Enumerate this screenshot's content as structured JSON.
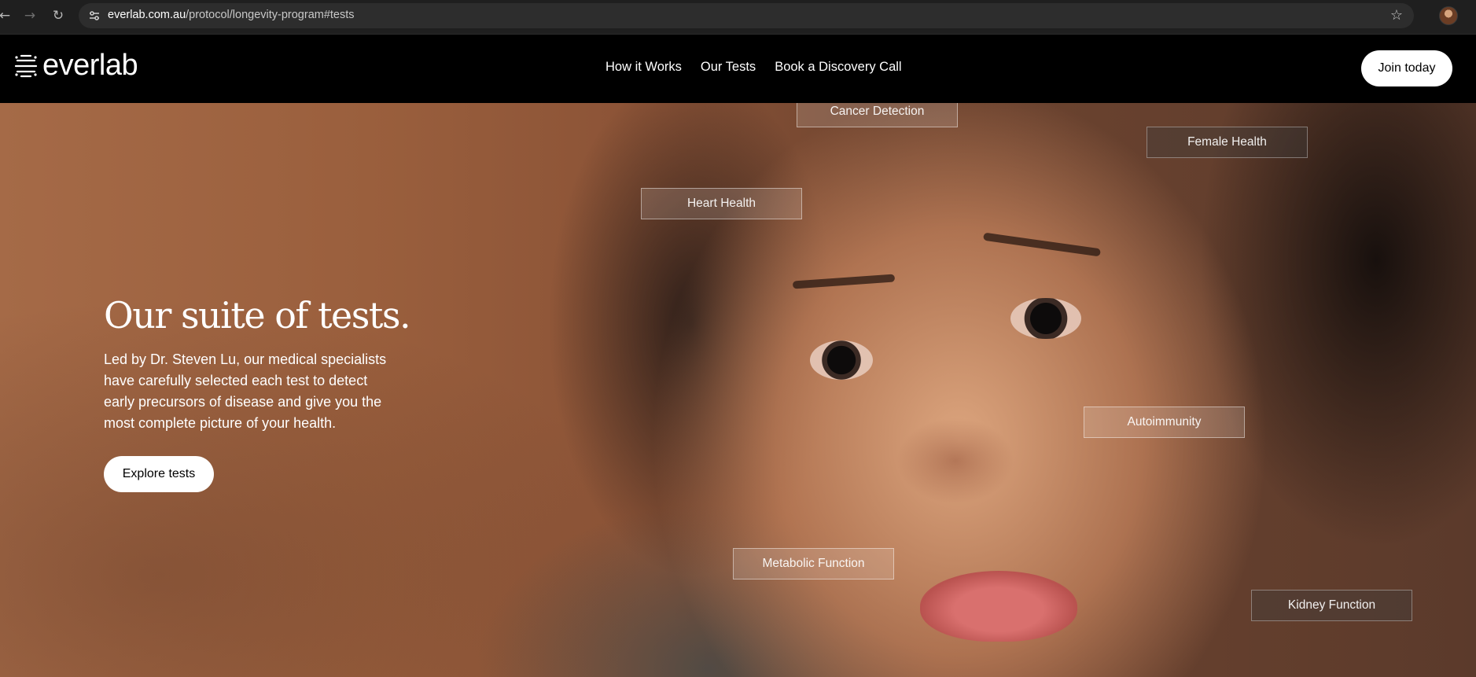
{
  "browser": {
    "url_host": "everlab.com.au",
    "url_path": "/protocol/longevity-program#tests",
    "icons": [
      "back-arrow-icon",
      "forward-arrow-icon",
      "reload-icon",
      "site-info-icon",
      "bookmark-star-icon",
      "profile-avatar"
    ]
  },
  "header": {
    "logo_text": "everlab",
    "nav": [
      "How it Works",
      "Our Tests",
      "Book a Discovery Call"
    ],
    "cta": "Join today"
  },
  "hero": {
    "title": "Our suite of tests.",
    "description": "Led by Dr. Steven Lu, our medical specialists have carefully selected each test to detect early precursors of disease and give you the most complete picture of your health.",
    "cta": "Explore tests",
    "tags": [
      "Cancer Detection",
      "Female Health",
      "Heart Health",
      "Autoimmunity",
      "Metabolic Function",
      "Kidney Function"
    ]
  },
  "colors": {
    "header_bg": "#000000",
    "button_bg": "#ffffff",
    "button_text": "#000000",
    "hero_warm": "#a56a47"
  }
}
